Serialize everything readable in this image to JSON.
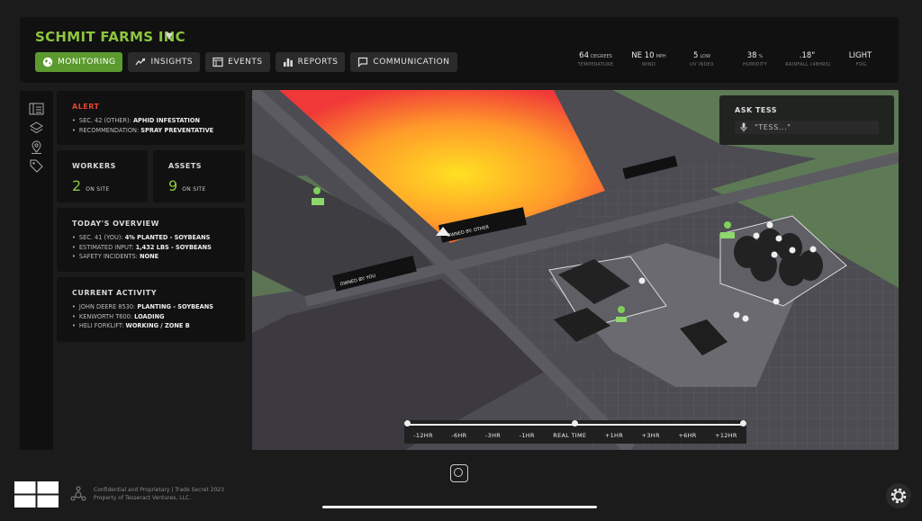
{
  "header": {
    "farm_name": "SCHMIT FARMS INC",
    "nav": [
      {
        "label": "MONITORING",
        "icon": "globe-icon",
        "active": true
      },
      {
        "label": "INSIGHTS",
        "icon": "trend-icon",
        "active": false
      },
      {
        "label": "EVENTS",
        "icon": "calendar-icon",
        "active": false
      },
      {
        "label": "REPORTS",
        "icon": "bar-chart-icon",
        "active": false
      },
      {
        "label": "COMMUNICATION",
        "icon": "chat-icon",
        "active": false
      }
    ],
    "weather": [
      {
        "value": "64",
        "unit": "DEGREES",
        "label": "TEMPERATURE"
      },
      {
        "value": "NE 10",
        "unit": "MPH",
        "label": "WIND"
      },
      {
        "value": "5",
        "unit": "LOW",
        "label": "UV INDEX"
      },
      {
        "value": "38",
        "unit": "%",
        "label": "HUMIDITY"
      },
      {
        "value": ".18\"",
        "unit": "",
        "label": "RAINFALL (48HRS)"
      },
      {
        "value": "LIGHT",
        "unit": "",
        "label": "FOG"
      }
    ]
  },
  "alert": {
    "title": "ALERT",
    "items": [
      {
        "key": "SEC. 42 (OTHER):",
        "val": "APHID INFESTATION"
      },
      {
        "key": "RECOMMENDATION:",
        "val": "SPRAY PREVENTATIVE"
      }
    ]
  },
  "workers": {
    "title": "WORKERS",
    "count": "2",
    "suffix": "ON SITE"
  },
  "assets": {
    "title": "ASSETS",
    "count": "9",
    "suffix": "ON SITE"
  },
  "overview": {
    "title": "TODAY'S OVERVIEW",
    "items": [
      {
        "key": "SEC. 41 (YOU):",
        "val": "4% PLANTED - SOYBEANS"
      },
      {
        "key": "ESTIMATED INPUT:",
        "val": "1,432 LBS - SOYBEANS"
      },
      {
        "key": "SAFETY INCIDENTS:",
        "val": "NONE"
      }
    ]
  },
  "activity": {
    "title": "CURRENT ACTIVITY",
    "items": [
      {
        "key": "JOHN DEERE 8530:",
        "val": "PLANTING - SOYBEANS"
      },
      {
        "key": "KENWORTH T600:",
        "val": "LOADING"
      },
      {
        "key": "HELI FORKLIFT:",
        "val": "WORKING / ZONE B"
      }
    ]
  },
  "tess": {
    "title": "ASK TESS",
    "placeholder": "\"TESS...\""
  },
  "map_labels": {
    "owned_other": "OWNED BY: OTHER",
    "owned_you": "OWNED BY: YOU"
  },
  "timeline": {
    "ticks": [
      "-12HR",
      "-6HR",
      "-3HR",
      "-1HR",
      "REAL TIME",
      "+1HR",
      "+3HR",
      "+6HR",
      "+12HR"
    ],
    "current": "REAL TIME"
  },
  "footer": {
    "line1": "Confidential and Proprietary | Trade Secret 2023",
    "line2": "Property of Tesseract Ventures, LLC."
  }
}
